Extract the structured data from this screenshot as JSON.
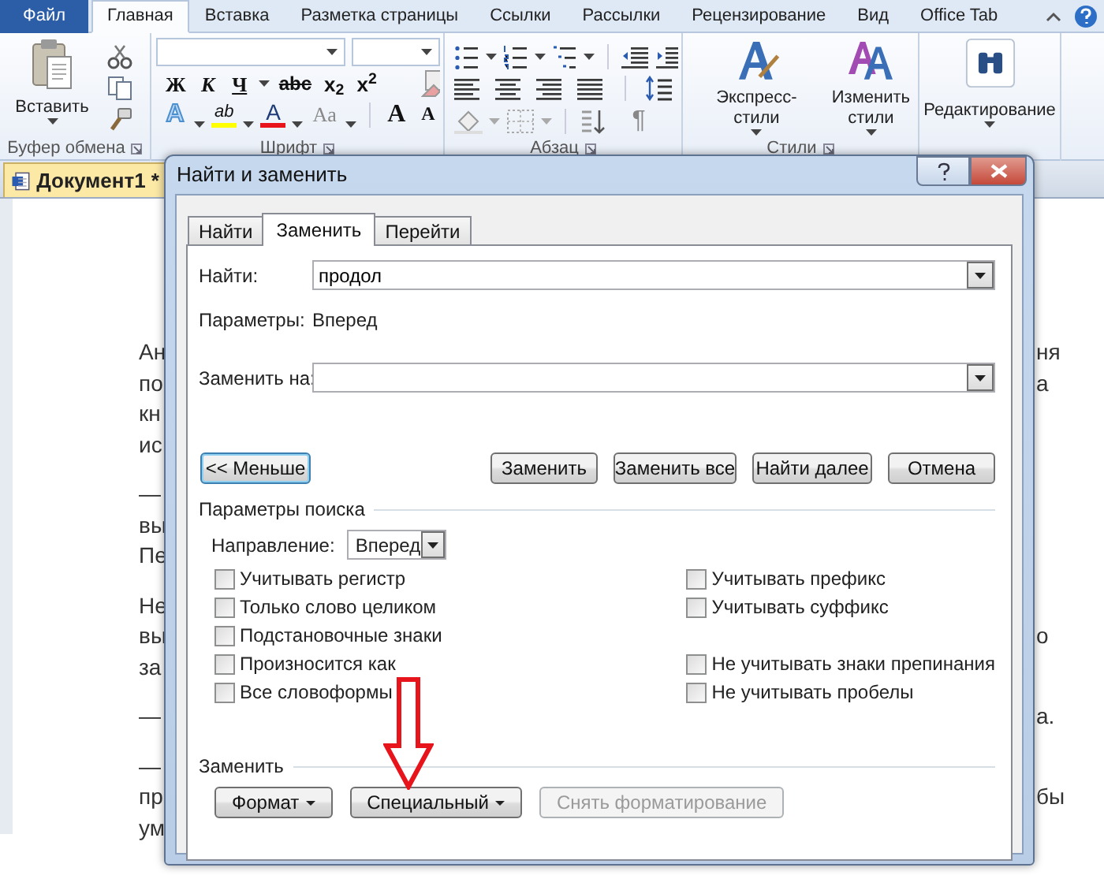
{
  "ribbon": {
    "tabs": [
      {
        "label": "Файл",
        "kind": "file",
        "selected": false
      },
      {
        "label": "Главная",
        "kind": "tab",
        "selected": true
      },
      {
        "label": "Вставка",
        "kind": "tab",
        "selected": false
      },
      {
        "label": "Разметка страницы",
        "kind": "tab",
        "selected": false
      },
      {
        "label": "Ссылки",
        "kind": "tab",
        "selected": false
      },
      {
        "label": "Рассылки",
        "kind": "tab",
        "selected": false
      },
      {
        "label": "Рецензирование",
        "kind": "tab",
        "selected": false
      },
      {
        "label": "Вид",
        "kind": "tab",
        "selected": false
      },
      {
        "label": "Office Tab",
        "kind": "tab",
        "selected": false
      }
    ],
    "groups": [
      {
        "kind": "clipboard",
        "label": "Буфер обмена",
        "button": "Вставить"
      },
      {
        "kind": "font",
        "label": "Шрифт",
        "format_buttons": [
          {
            "glyph": "Ж",
            "kind": "bold"
          },
          {
            "glyph": "К",
            "kind": "italic"
          },
          {
            "glyph": "Ч",
            "kind": "underline"
          },
          {
            "glyph": "abc",
            "kind": "strike"
          },
          {
            "glyph": "x$_{2}$",
            "kind": "sub"
          },
          {
            "glyph": "x$^{2}$",
            "kind": "sup"
          }
        ],
        "effect_buttons": [
          {
            "glyph": "A",
            "kind": "effect"
          },
          {
            "glyph": "ab",
            "kind": "highlight"
          },
          {
            "glyph": "A",
            "kind": "color"
          },
          {
            "glyph": "Aa",
            "kind": "case"
          },
          {
            "glyph": "A",
            "kind": "grow"
          },
          {
            "glyph": "A",
            "kind": "shrink"
          }
        ]
      },
      {
        "kind": "paragraph",
        "label": "Абзац",
        "pilcrow": "¶"
      },
      {
        "kind": "styles",
        "label": "Стили",
        "buttons": [
          "Экспресс-стили",
          "Изменить стили"
        ]
      },
      {
        "kind": "editing",
        "button": "Редактирование"
      }
    ]
  },
  "document_tab": {
    "title": "Документ1 *"
  },
  "document": {
    "paragraphs": [
      [
        {
          "start": "Ан",
          "end": "ня"
        },
        {
          "start": "по",
          "end": "а"
        },
        {
          "start": "кн"
        },
        {
          "start": "ис"
        }
      ],
      [
        {
          "start": "—"
        },
        {
          "start": "вы"
        },
        {
          "start": "Пе"
        }
      ],
      [
        {
          "start": "Не"
        },
        {
          "start": "вы",
          "end": "о"
        },
        {
          "start": "за"
        }
      ],
      [
        {
          "start": "—",
          "end": "а."
        }
      ],
      [
        {
          "start": "—"
        },
        {
          "start": "пр",
          "end": "бы"
        },
        {
          "start": "ум"
        }
      ]
    ]
  },
  "dialog": {
    "title": "Найти и заменить",
    "tabs": [
      {
        "label": "Найти",
        "selected": false
      },
      {
        "label": "Заменить",
        "selected": true
      },
      {
        "label": "Перейти",
        "selected": false
      }
    ],
    "find": {
      "label": "Найти:",
      "value": "продол"
    },
    "parameters": {
      "label": "Параметры:",
      "value": "Вперед"
    },
    "replace": {
      "label": "Заменить на:"
    },
    "buttons": [
      {
        "label": "<< Меньше",
        "kind": "left",
        "focused": true
      },
      {
        "label": "Заменить",
        "kind": "right",
        "focused": false
      },
      {
        "label": "Заменить все",
        "kind": "right",
        "focused": false
      },
      {
        "label": "Найти далее",
        "kind": "right",
        "focused": false
      },
      {
        "label": "Отмена",
        "kind": "right",
        "focused": false
      }
    ],
    "search_options": {
      "title": "Параметры поиска",
      "direction": {
        "label": "Направление:",
        "value": "Вперед"
      },
      "left": [
        {
          "label": "Учитывать регистр",
          "checked": false
        },
        {
          "label": "Только слово целиком",
          "checked": false
        },
        {
          "label": "Подстановочные знаки",
          "checked": false
        },
        {
          "label": "Произносится как",
          "checked": false
        },
        {
          "label": "Все словоформы",
          "checked": false
        }
      ],
      "right_groups": [
        [
          {
            "label": "Учитывать префикс",
            "checked": false
          },
          {
            "label": "Учитывать суффикс",
            "checked": false
          }
        ],
        [
          {
            "label": "Не учитывать знаки препинания",
            "checked": false
          },
          {
            "label": "Не учитывать пробелы",
            "checked": false
          }
        ]
      ]
    },
    "replace_section": {
      "title": "Заменить",
      "buttons": [
        {
          "label": "Формат",
          "menu": true,
          "disabled": false
        },
        {
          "label": "Специальный",
          "menu": true,
          "disabled": false
        },
        {
          "label": "Снять форматирование",
          "menu": false,
          "disabled": true
        }
      ]
    }
  }
}
